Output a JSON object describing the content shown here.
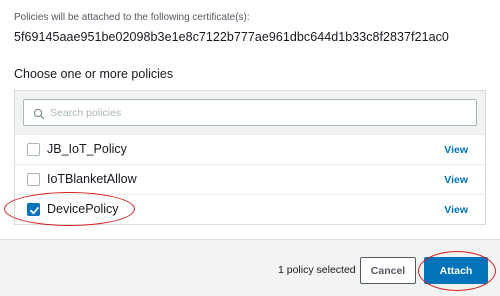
{
  "certificate": {
    "intro": "Policies will be attached to the following certificate(s):",
    "id": "5f69145aae951be02098b3e1e8c7122b777ae961dbc644d1b33c8f2837f21ac0"
  },
  "policies_section": {
    "title": "Choose one or more policies",
    "search": {
      "placeholder": "Search policies",
      "value": ""
    },
    "items": [
      {
        "name": "JB_IoT_Policy",
        "checked": false,
        "view_label": "View"
      },
      {
        "name": "IoTBlanketAllow",
        "checked": false,
        "view_label": "View"
      },
      {
        "name": "DevicePolicy",
        "checked": true,
        "view_label": "View"
      }
    ]
  },
  "footer": {
    "selected_count": "1 policy selected",
    "cancel_label": "Cancel",
    "attach_label": "Attach"
  },
  "colors": {
    "primary": "#0073bb",
    "annotation": "#d41f1f",
    "footer_bg": "#f2f3f3"
  }
}
